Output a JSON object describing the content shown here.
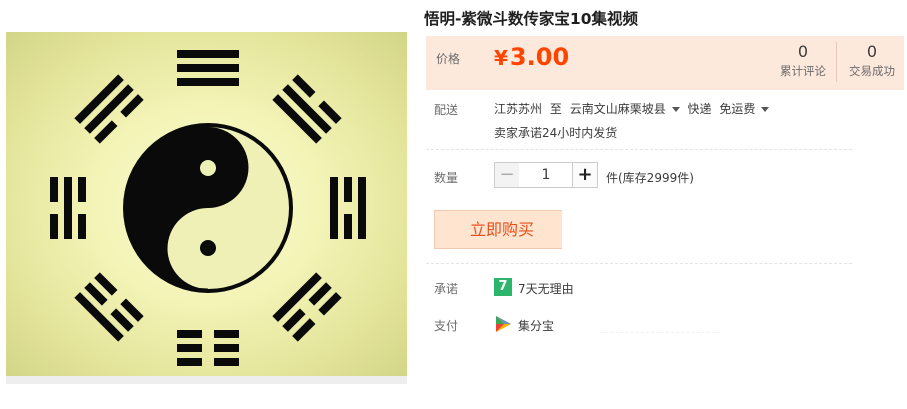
{
  "product": {
    "title": "悟明-紫微斗数传家宝10集视频",
    "image_icon": "bagua-yin-yang-image"
  },
  "price": {
    "label": "价格",
    "currency": "¥",
    "amount": "3.00",
    "color": "#ff4400"
  },
  "stats": {
    "reviews_count": "0",
    "reviews_label": "累计评论",
    "trades_count": "0",
    "trades_label": "交易成功"
  },
  "shipping": {
    "label": "配送",
    "from": "江苏苏州",
    "to_word": "至",
    "destination": "云南文山麻栗坡县",
    "method": "快递",
    "fee": "免运费",
    "promise": "卖家承诺24小时内发货"
  },
  "quantity": {
    "label": "数量",
    "minus": "−",
    "value": "1",
    "plus": "+",
    "unit_stock": "件(库存2999件)"
  },
  "buy": {
    "label": "立即购买"
  },
  "guarantee": {
    "label": "承诺",
    "badge": "7",
    "text": "7天无理由"
  },
  "payment": {
    "label": "支付",
    "icon": "jifenbao-icon",
    "text": "集分宝"
  },
  "colors": {
    "accent": "#ff4400",
    "price_panel_bg": "#fde8dc",
    "buy_bg": "#ffe4d0",
    "guarantee_green": "#2cb56b"
  }
}
